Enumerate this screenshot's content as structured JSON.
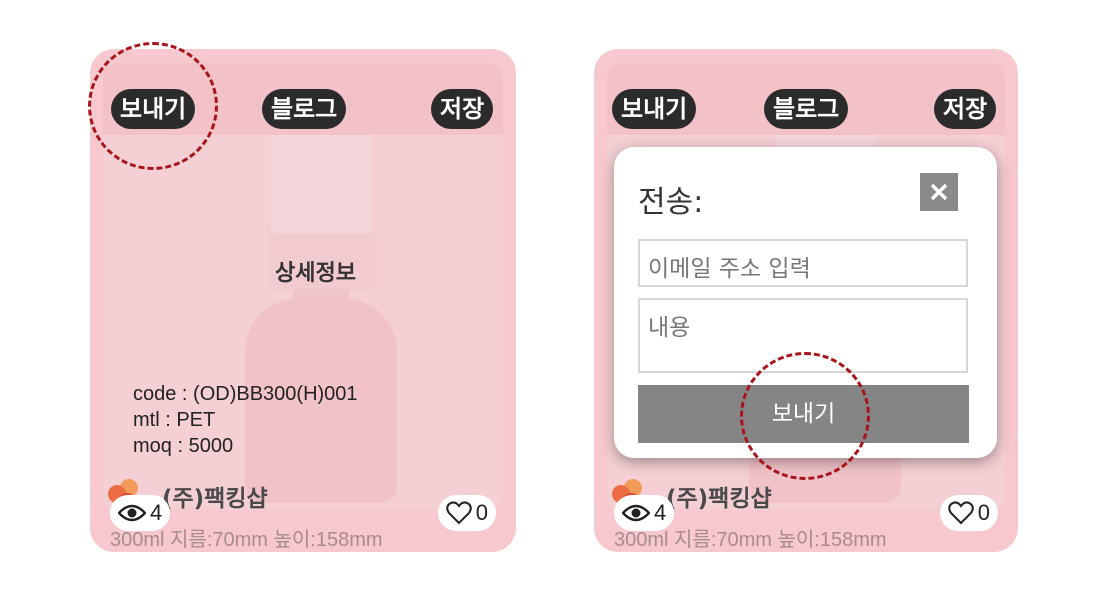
{
  "left_card": {
    "tags": {
      "send": "보내기",
      "blog": "블로그",
      "save": "저장"
    },
    "detail_label": "상세정보",
    "specs": [
      "code : (OD)BB300(H)001",
      "mtl : PET",
      "moq : 5000"
    ],
    "company": "(주)팩킹샵",
    "views": "4",
    "likes": "0",
    "dimensions": "300ml 지름:70mm 높이:158mm"
  },
  "right_card": {
    "tags": {
      "send": "보내기",
      "blog": "블로그",
      "save": "저장"
    },
    "company": "(주)팩킹샵",
    "views": "4",
    "likes": "0",
    "dimensions": "300ml 지름:70mm 높이:158mm"
  },
  "modal": {
    "title": "전송:",
    "close_icon": "close-icon",
    "email_placeholder": "이메일 주소 입력",
    "content_placeholder": "내용",
    "send_label": "보내기"
  },
  "colors": {
    "card_bg": "#f7c8cd",
    "tag_bg": "#2b2b2b",
    "highlight": "#a8141c",
    "send_button": "#858585"
  }
}
